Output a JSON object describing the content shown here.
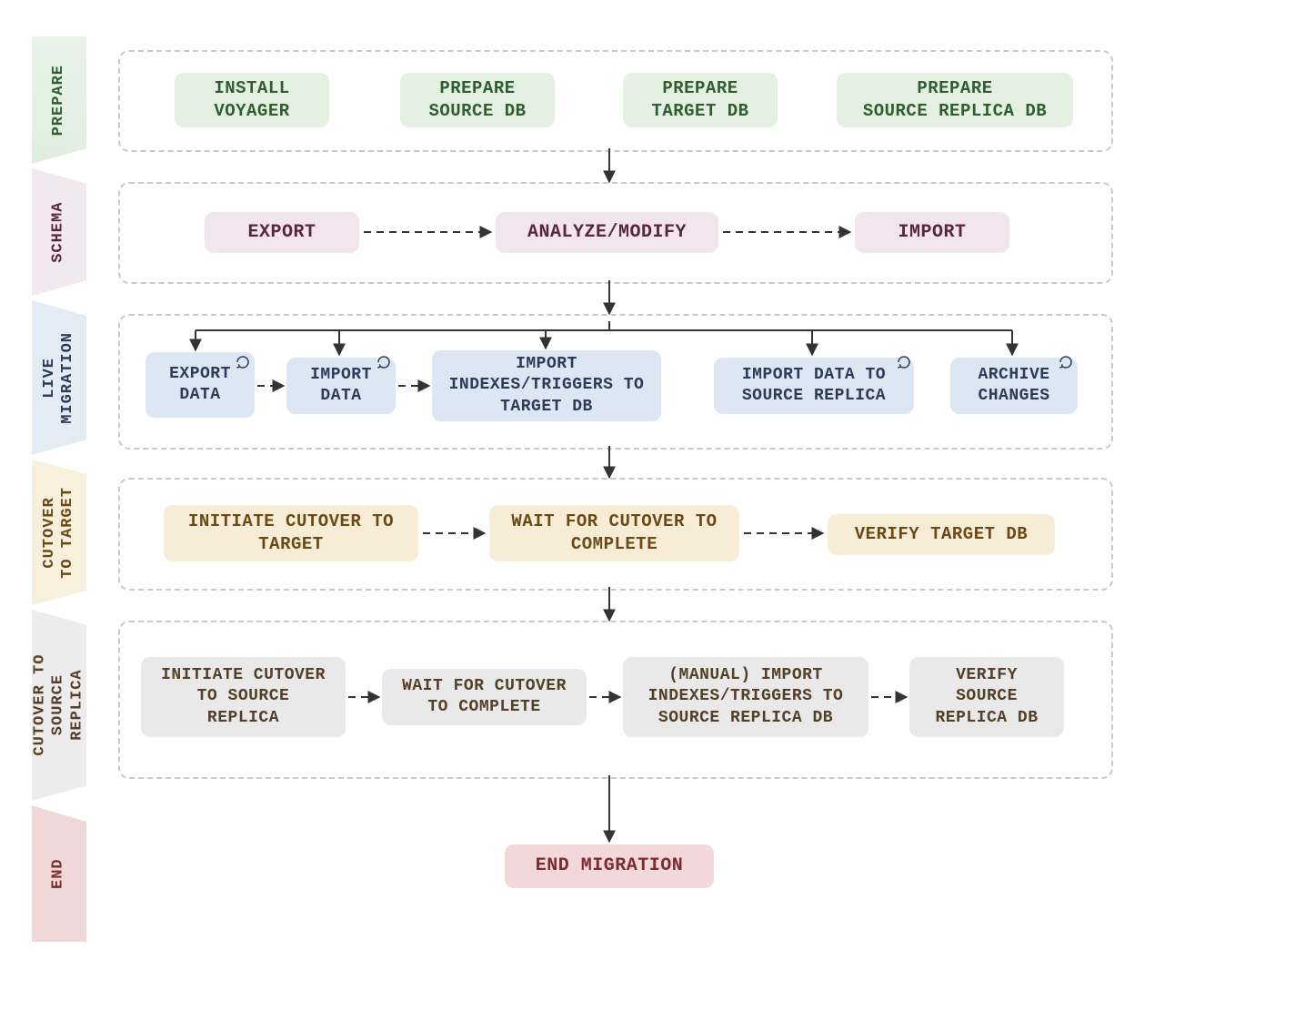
{
  "sidebar": {
    "prepare": "PREPARE",
    "schema": "SCHEMA",
    "live": "LIVE\nMIGRATION",
    "cutover_target": "CUTOVER\nTO TARGET",
    "cutover_replica": "CUTOVER TO\nSOURCE\nREPLICA",
    "end": "END"
  },
  "prepare": {
    "install": "INSTALL\nVOYAGER",
    "source": "PREPARE\nSOURCE DB",
    "target": "PREPARE\nTARGET DB",
    "replica": "PREPARE\nSOURCE REPLICA DB"
  },
  "schema": {
    "export": "EXPORT",
    "analyze": "ANALYZE/MODIFY",
    "import": "IMPORT"
  },
  "live": {
    "export_data": "EXPORT\nDATA",
    "import_data": "IMPORT\nDATA",
    "import_idx": "IMPORT\nINDEXES/TRIGGERS TO\nTARGET DB",
    "import_to_replica": "IMPORT DATA TO\nSOURCE REPLICA",
    "archive": "ARCHIVE\nCHANGES"
  },
  "cutover_target": {
    "initiate": "INITIATE CUTOVER TO\nTARGET",
    "wait": "WAIT FOR CUTOVER TO\nCOMPLETE",
    "verify": "VERIFY TARGET DB"
  },
  "cutover_replica": {
    "initiate": "INITIATE CUTOVER\nTO SOURCE\nREPLICA",
    "wait": "WAIT FOR CUTOVER\nTO COMPLETE",
    "import_idx": "(MANUAL) IMPORT\nINDEXES/TRIGGERS TO\nSOURCE REPLICA DB",
    "verify": "VERIFY\nSOURCE\nREPLICA DB"
  },
  "end": {
    "end_migration": "END MIGRATION"
  },
  "icons": {
    "loop": "loop-icon"
  }
}
